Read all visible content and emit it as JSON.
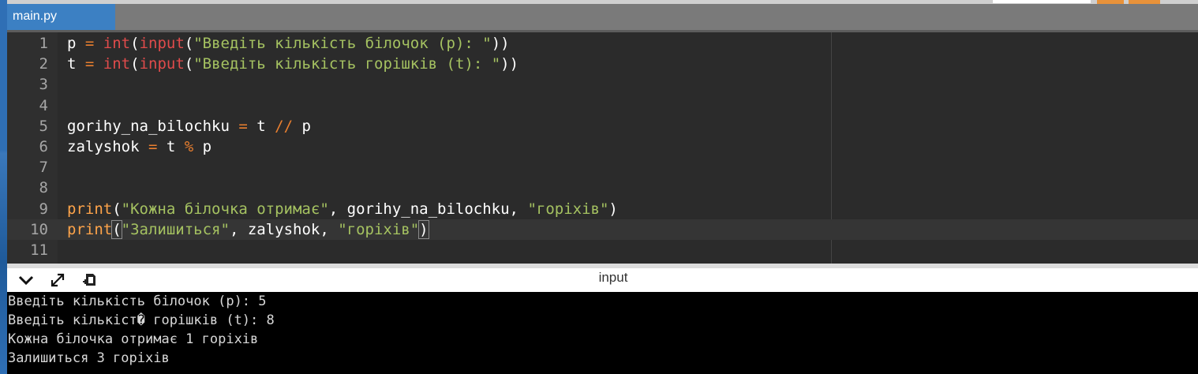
{
  "tab": {
    "label": "main.py"
  },
  "editor": {
    "lines": [
      {
        "n": "1",
        "parts": [
          [
            "txt",
            "p "
          ],
          [
            "op",
            "="
          ],
          [
            "txt",
            " "
          ],
          [
            "kw",
            "int"
          ],
          [
            "txt",
            "("
          ],
          [
            "kw",
            "input"
          ],
          [
            "txt",
            "("
          ],
          [
            "str",
            "\"Введіть кількість білочок (p): \""
          ],
          [
            "txt",
            "))"
          ]
        ]
      },
      {
        "n": "2",
        "parts": [
          [
            "txt",
            "t "
          ],
          [
            "op",
            "="
          ],
          [
            "txt",
            " "
          ],
          [
            "kw",
            "int"
          ],
          [
            "txt",
            "("
          ],
          [
            "kw",
            "input"
          ],
          [
            "txt",
            "("
          ],
          [
            "str",
            "\"Введіть кількість горішків (t): \""
          ],
          [
            "txt",
            "))"
          ]
        ]
      },
      {
        "n": "3",
        "parts": []
      },
      {
        "n": "4",
        "parts": []
      },
      {
        "n": "5",
        "parts": [
          [
            "txt",
            "gorihy_na_bilochku "
          ],
          [
            "op",
            "="
          ],
          [
            "txt",
            " t "
          ],
          [
            "op",
            "//"
          ],
          [
            "txt",
            " p"
          ]
        ]
      },
      {
        "n": "6",
        "parts": [
          [
            "txt",
            "zalyshok "
          ],
          [
            "op",
            "="
          ],
          [
            "txt",
            " t "
          ],
          [
            "op",
            "%"
          ],
          [
            "txt",
            " p"
          ]
        ]
      },
      {
        "n": "7",
        "parts": []
      },
      {
        "n": "8",
        "parts": []
      },
      {
        "n": "9",
        "parts": [
          [
            "fn",
            "print"
          ],
          [
            "txt",
            "("
          ],
          [
            "str",
            "\"Кожна білочка отримає\""
          ],
          [
            "txt",
            ", gorihy_na_bilochku, "
          ],
          [
            "str",
            "\"горіхів\""
          ],
          [
            "txt",
            ")"
          ]
        ]
      },
      {
        "n": "10",
        "active": true,
        "parts": [
          [
            "fn",
            "print"
          ],
          [
            "bh",
            "("
          ],
          [
            "str",
            "\"Залишиться\""
          ],
          [
            "txt",
            ", zalyshok, "
          ],
          [
            "str",
            "\"горіхів\""
          ],
          [
            "bh",
            ")"
          ],
          [
            "cur",
            ""
          ]
        ]
      },
      {
        "n": "11",
        "parts": []
      }
    ]
  },
  "console": {
    "title": "input",
    "icons": [
      "chevron-down-icon",
      "expand-icon",
      "clear-icon"
    ],
    "output": [
      "Введіть кількість білочок (p): 5",
      "Введіть кількіст� горішків (t): 8",
      "Кожна білочка отримає 1 горіхів",
      "Залишиться 3 горіхів"
    ]
  }
}
